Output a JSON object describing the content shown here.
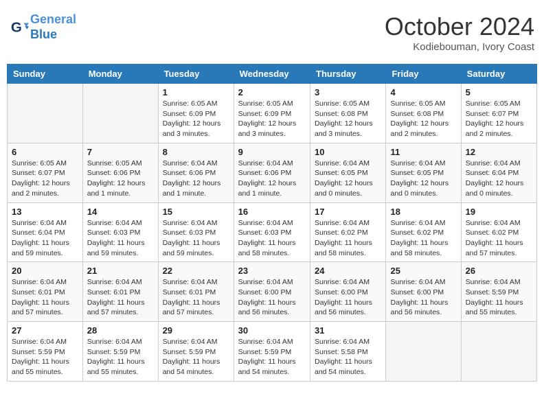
{
  "header": {
    "logo_line1": "General",
    "logo_line2": "Blue",
    "month_year": "October 2024",
    "location": "Kodiebouman, Ivory Coast"
  },
  "weekdays": [
    "Sunday",
    "Monday",
    "Tuesday",
    "Wednesday",
    "Thursday",
    "Friday",
    "Saturday"
  ],
  "weeks": [
    [
      {
        "day": "",
        "info": ""
      },
      {
        "day": "",
        "info": ""
      },
      {
        "day": "1",
        "info": "Sunrise: 6:05 AM\nSunset: 6:09 PM\nDaylight: 12 hours\nand 3 minutes."
      },
      {
        "day": "2",
        "info": "Sunrise: 6:05 AM\nSunset: 6:09 PM\nDaylight: 12 hours\nand 3 minutes."
      },
      {
        "day": "3",
        "info": "Sunrise: 6:05 AM\nSunset: 6:08 PM\nDaylight: 12 hours\nand 3 minutes."
      },
      {
        "day": "4",
        "info": "Sunrise: 6:05 AM\nSunset: 6:08 PM\nDaylight: 12 hours\nand 2 minutes."
      },
      {
        "day": "5",
        "info": "Sunrise: 6:05 AM\nSunset: 6:07 PM\nDaylight: 12 hours\nand 2 minutes."
      }
    ],
    [
      {
        "day": "6",
        "info": "Sunrise: 6:05 AM\nSunset: 6:07 PM\nDaylight: 12 hours\nand 2 minutes."
      },
      {
        "day": "7",
        "info": "Sunrise: 6:05 AM\nSunset: 6:06 PM\nDaylight: 12 hours\nand 1 minute."
      },
      {
        "day": "8",
        "info": "Sunrise: 6:04 AM\nSunset: 6:06 PM\nDaylight: 12 hours\nand 1 minute."
      },
      {
        "day": "9",
        "info": "Sunrise: 6:04 AM\nSunset: 6:06 PM\nDaylight: 12 hours\nand 1 minute."
      },
      {
        "day": "10",
        "info": "Sunrise: 6:04 AM\nSunset: 6:05 PM\nDaylight: 12 hours\nand 0 minutes."
      },
      {
        "day": "11",
        "info": "Sunrise: 6:04 AM\nSunset: 6:05 PM\nDaylight: 12 hours\nand 0 minutes."
      },
      {
        "day": "12",
        "info": "Sunrise: 6:04 AM\nSunset: 6:04 PM\nDaylight: 12 hours\nand 0 minutes."
      }
    ],
    [
      {
        "day": "13",
        "info": "Sunrise: 6:04 AM\nSunset: 6:04 PM\nDaylight: 11 hours\nand 59 minutes."
      },
      {
        "day": "14",
        "info": "Sunrise: 6:04 AM\nSunset: 6:03 PM\nDaylight: 11 hours\nand 59 minutes."
      },
      {
        "day": "15",
        "info": "Sunrise: 6:04 AM\nSunset: 6:03 PM\nDaylight: 11 hours\nand 59 minutes."
      },
      {
        "day": "16",
        "info": "Sunrise: 6:04 AM\nSunset: 6:03 PM\nDaylight: 11 hours\nand 58 minutes."
      },
      {
        "day": "17",
        "info": "Sunrise: 6:04 AM\nSunset: 6:02 PM\nDaylight: 11 hours\nand 58 minutes."
      },
      {
        "day": "18",
        "info": "Sunrise: 6:04 AM\nSunset: 6:02 PM\nDaylight: 11 hours\nand 58 minutes."
      },
      {
        "day": "19",
        "info": "Sunrise: 6:04 AM\nSunset: 6:02 PM\nDaylight: 11 hours\nand 57 minutes."
      }
    ],
    [
      {
        "day": "20",
        "info": "Sunrise: 6:04 AM\nSunset: 6:01 PM\nDaylight: 11 hours\nand 57 minutes."
      },
      {
        "day": "21",
        "info": "Sunrise: 6:04 AM\nSunset: 6:01 PM\nDaylight: 11 hours\nand 57 minutes."
      },
      {
        "day": "22",
        "info": "Sunrise: 6:04 AM\nSunset: 6:01 PM\nDaylight: 11 hours\nand 57 minutes."
      },
      {
        "day": "23",
        "info": "Sunrise: 6:04 AM\nSunset: 6:00 PM\nDaylight: 11 hours\nand 56 minutes."
      },
      {
        "day": "24",
        "info": "Sunrise: 6:04 AM\nSunset: 6:00 PM\nDaylight: 11 hours\nand 56 minutes."
      },
      {
        "day": "25",
        "info": "Sunrise: 6:04 AM\nSunset: 6:00 PM\nDaylight: 11 hours\nand 56 minutes."
      },
      {
        "day": "26",
        "info": "Sunrise: 6:04 AM\nSunset: 5:59 PM\nDaylight: 11 hours\nand 55 minutes."
      }
    ],
    [
      {
        "day": "27",
        "info": "Sunrise: 6:04 AM\nSunset: 5:59 PM\nDaylight: 11 hours\nand 55 minutes."
      },
      {
        "day": "28",
        "info": "Sunrise: 6:04 AM\nSunset: 5:59 PM\nDaylight: 11 hours\nand 55 minutes."
      },
      {
        "day": "29",
        "info": "Sunrise: 6:04 AM\nSunset: 5:59 PM\nDaylight: 11 hours\nand 54 minutes."
      },
      {
        "day": "30",
        "info": "Sunrise: 6:04 AM\nSunset: 5:59 PM\nDaylight: 11 hours\nand 54 minutes."
      },
      {
        "day": "31",
        "info": "Sunrise: 6:04 AM\nSunset: 5:58 PM\nDaylight: 11 hours\nand 54 minutes."
      },
      {
        "day": "",
        "info": ""
      },
      {
        "day": "",
        "info": ""
      }
    ]
  ]
}
